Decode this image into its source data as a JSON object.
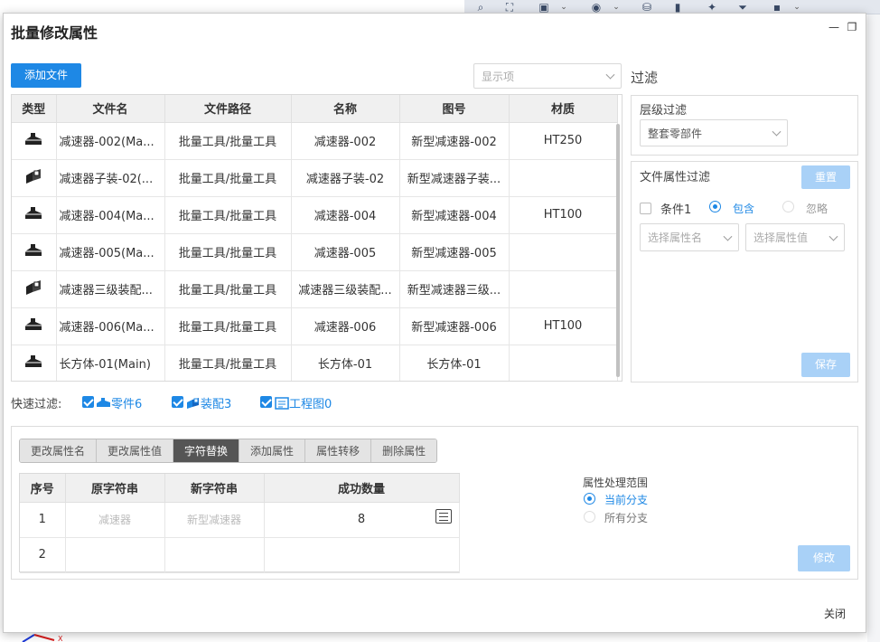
{
  "dialog": {
    "title": "批量修改属性",
    "close_label": "关闭"
  },
  "toolbar": {
    "add_file_label": "添加文件",
    "display_select_placeholder": "显示项"
  },
  "files_table": {
    "columns": [
      "类型",
      "文件名",
      "文件路径",
      "名称",
      "图号",
      "材质"
    ],
    "rows": [
      {
        "type": "part-icon",
        "filename": "减速器-002(Ma...",
        "path": "批量工具/批量工具",
        "name": "减速器-002",
        "drawing_no": "新型减速器-002",
        "material": "HT250"
      },
      {
        "type": "assembly-icon",
        "filename": "减速器子装-02(...",
        "path": "批量工具/批量工具",
        "name": "减速器子装-02",
        "drawing_no": "新型减速器子装...",
        "material": ""
      },
      {
        "type": "part-icon",
        "filename": "减速器-004(Ma...",
        "path": "批量工具/批量工具",
        "name": "减速器-004",
        "drawing_no": "新型减速器-004",
        "material": "HT100"
      },
      {
        "type": "part-icon",
        "filename": "减速器-005(Ma...",
        "path": "批量工具/批量工具",
        "name": "减速器-005",
        "drawing_no": "新型减速器-005",
        "material": ""
      },
      {
        "type": "assembly-icon",
        "filename": "减速器三级装配...",
        "path": "批量工具/批量工具",
        "name": "减速器三级装配...",
        "drawing_no": "新型减速器三级...",
        "material": ""
      },
      {
        "type": "part-icon",
        "filename": "减速器-006(Ma...",
        "path": "批量工具/批量工具",
        "name": "减速器-006",
        "drawing_no": "新型减速器-006",
        "material": "HT100"
      },
      {
        "type": "part-icon",
        "filename": "长方体-01(Main)",
        "path": "批量工具/批量工具",
        "name": "长方体-01",
        "drawing_no": "长方体-01",
        "material": ""
      }
    ]
  },
  "filter": {
    "title": "过滤",
    "level_filter": {
      "label": "层级过滤",
      "selected": "整套零部件"
    },
    "file_attr_filter": {
      "label": "文件属性过滤",
      "reset_label": "重置",
      "condition_label": "条件1",
      "include_label": "包含",
      "ignore_label": "忽略",
      "attr_name_placeholder": "选择属性名",
      "attr_value_placeholder": "选择属性值",
      "save_label": "保存"
    }
  },
  "quick_filter": {
    "label": "快速过滤:",
    "items": [
      {
        "label": "零件6",
        "checked": true
      },
      {
        "label": "装配3",
        "checked": true
      },
      {
        "label": "工程图0",
        "checked": true
      }
    ]
  },
  "edit_tabs": [
    {
      "label": "更改属性名",
      "active": false
    },
    {
      "label": "更改属性值",
      "active": false
    },
    {
      "label": "字符替换",
      "active": true
    },
    {
      "label": "添加属性",
      "active": false
    },
    {
      "label": "属性转移",
      "active": false
    },
    {
      "label": "删除属性",
      "active": false
    }
  ],
  "replace_table": {
    "columns": [
      "序号",
      "原字符串",
      "新字符串",
      "成功数量"
    ],
    "rows": [
      {
        "index": "1",
        "old": "减速器",
        "new": "新型减速器",
        "count": "8"
      },
      {
        "index": "2",
        "old": "",
        "new": "",
        "count": ""
      }
    ]
  },
  "scope": {
    "label": "属性处理范围",
    "options": [
      {
        "label": "当前分支",
        "selected": true
      },
      {
        "label": "所有分支",
        "selected": false
      }
    ],
    "modify_label": "修改"
  },
  "colors": {
    "accent": "#1e88e5",
    "disabled_button": "#a9d1f7",
    "active_tab": "#555555"
  }
}
